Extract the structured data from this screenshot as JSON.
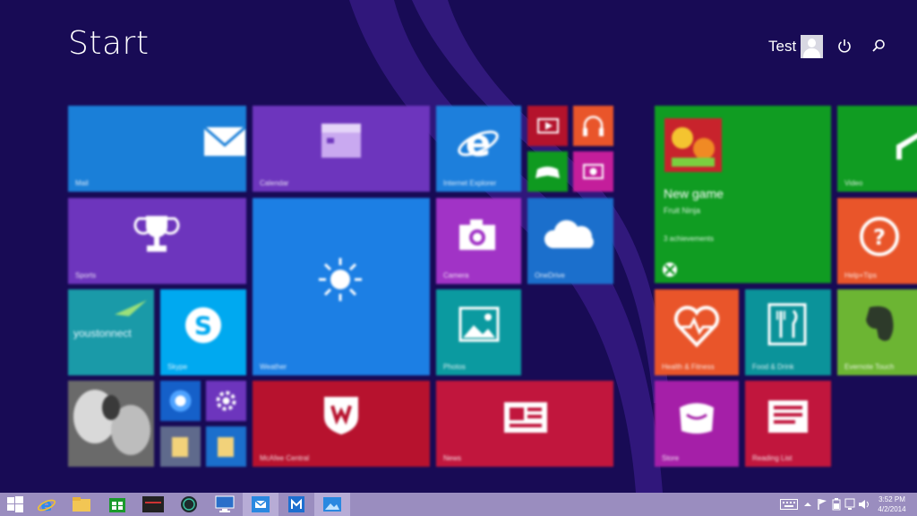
{
  "header": {
    "title": "Start",
    "user_name": "Test"
  },
  "tiles": {
    "mail": {
      "label": "Mail"
    },
    "calendar": {
      "label": "Calendar"
    },
    "ie": {
      "label": "Internet Explorer"
    },
    "sports": {
      "label": "Sports"
    },
    "weather": {
      "label": "Weather"
    },
    "camera": {
      "label": "Camera"
    },
    "onedrive": {
      "label": "OneDrive"
    },
    "youstonnect": {
      "label": "youstonnect"
    },
    "skype": {
      "label": "Skype"
    },
    "photos": {
      "label": "Photos"
    },
    "mcafee": {
      "label": "McAfee Central"
    },
    "news": {
      "label": "News"
    },
    "xbox_game": {
      "title": "New game",
      "subtitle": "Fruit Ninja",
      "count": "3 achievements"
    },
    "video": {
      "label": "Video"
    },
    "help": {
      "label": "Help+Tips"
    },
    "health": {
      "label": "Health & Fitness"
    },
    "food": {
      "label": "Food & Drink"
    },
    "evernote": {
      "label": "Evernote Touch"
    },
    "store_left": {
      "label": "Store"
    },
    "reading": {
      "label": "Reading List"
    }
  },
  "taskbar": {
    "clock_time": "3:52 PM",
    "clock_date": "4/2/2014"
  },
  "colors": {
    "background": "#180b55",
    "taskbar": "#9a8dbf",
    "blue": "#1c7fd6",
    "purple": "#6b31b8",
    "green": "#0f9a20",
    "red": "#b4132c",
    "orange": "#e9552a",
    "teal": "#0b939a"
  }
}
